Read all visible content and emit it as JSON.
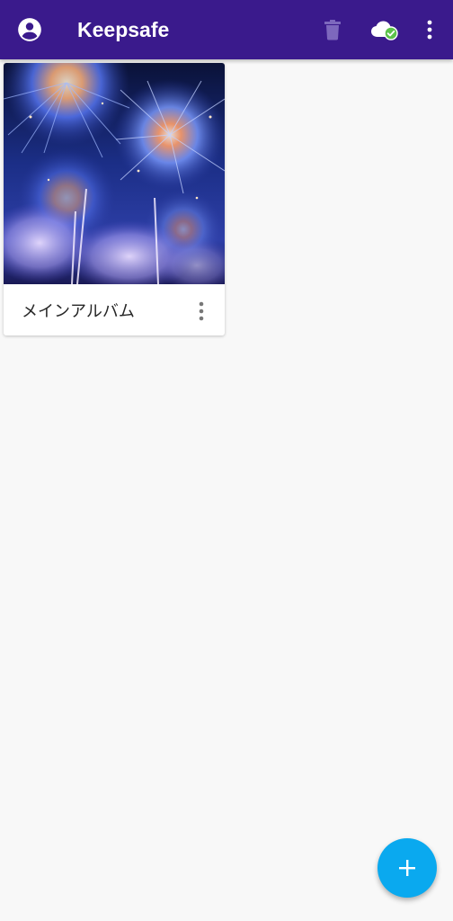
{
  "app_bar": {
    "title": "Keepsafe",
    "background_color": "#3a1a8c",
    "icons": {
      "account": "account-circle-icon",
      "trash": "trash-icon",
      "sync_status": "cloud-check-icon",
      "more": "more-vert-icon"
    },
    "trash_disabled": true
  },
  "albums": [
    {
      "name": "メインアルバム",
      "thumbnail": "fireworks photo"
    }
  ],
  "fab": {
    "icon": "plus-icon",
    "color": "#0aa9ef"
  }
}
